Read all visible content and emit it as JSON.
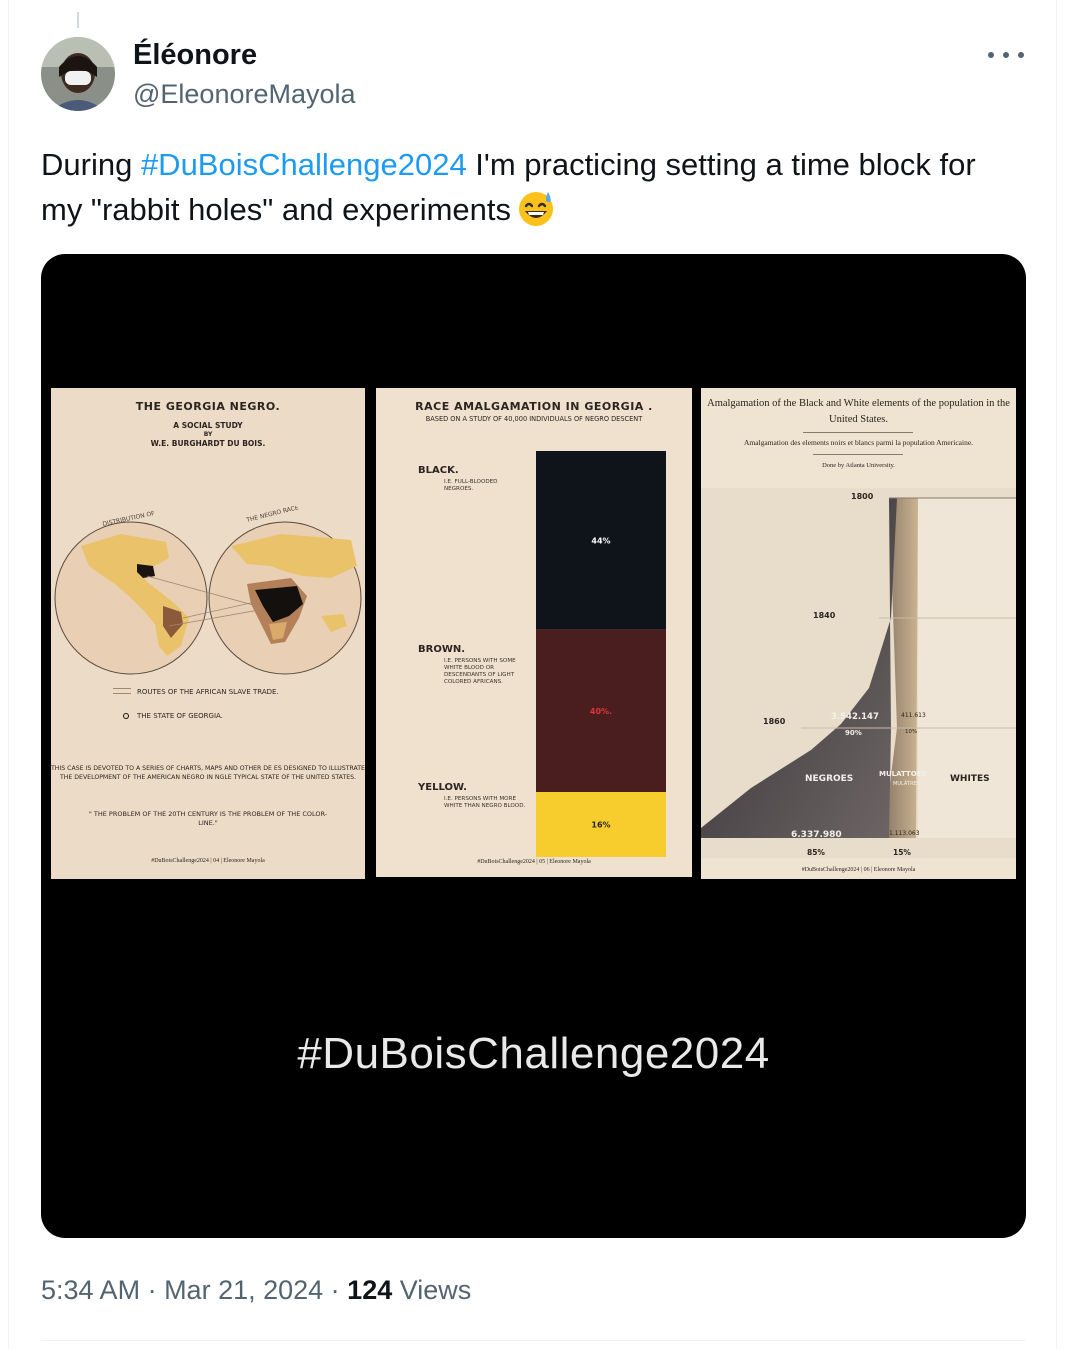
{
  "author": {
    "name": "Éléonore",
    "handle": "@EleonoreMayola"
  },
  "tweet": {
    "text_1": "During ",
    "hashtag": "#DuBoisChallenge2024",
    "text_2": " I'm practicing setting a time block for my \"rabbit holes\" and experiments",
    "emoji": "grinning-face-with-sweat-icon"
  },
  "media": {
    "panel1": {
      "title": "THE GEORGIA NEGRO.",
      "subtitle": "A SOCIAL STUDY",
      "by": "BY",
      "author": "W.E. BURGHARDT DU BOIS.",
      "arc_left": "DISTRIBUTION OF",
      "arc_right": "THE NEGRO RACE",
      "legend_routes": "ROUTES OF THE AFRICAN SLAVE TRADE.",
      "legend_state": "THE STATE OF GEORGIA.",
      "paragraph": "THIS CASE IS DEVOTED TO A SERIES OF CHARTS, MAPS AND OTHER DE ES DESIGNED TO ILLUSTRATE THE DEVELOPMENT OF THE AMERICAN NEGRO IN NGLE TYPICAL STATE OF THE UNITED STATES.",
      "quote": "\" THE PROBLEM OF THE 20TH CENTURY IS THE PROBLEM OF THE COLOR-LINE.\"",
      "footer": "#DuBoisChallenge2024 | 04 | Eleonore Mayola"
    },
    "panel2": {
      "title": "RACE AMALGAMATION IN GEORGIA .",
      "subtitle": "BASED ON A STUDY OF 40,000 INDIVIDUALS OF NEGRO DESCENT",
      "footer": "#DuBoisChallenge2024 | 05 | Eleonore Mayola",
      "chart_data": {
        "type": "bar",
        "stacked": true,
        "categories": [
          "BLACK.",
          "BROWN.",
          "YELLOW."
        ],
        "descriptions": [
          "I.E. FULL-BLOODED NEGROES.",
          "I.E. PERSONS WITH SOME WHITE BLOOD OR DESCENDANTS OF LIGHT COLORED AFRICANS.",
          "I.E. PERSONS WITH MORE WHITE THAN NEGRO BLOOD."
        ],
        "values": [
          44,
          40,
          16
        ],
        "labels": [
          "44%",
          "40%.",
          "16%"
        ],
        "colors": [
          "#0f131a",
          "#4a1d1f",
          "#f6cd2c"
        ],
        "label_colors": [
          "#ffffff",
          "#e0343c",
          "#2b2420"
        ]
      }
    },
    "panel3": {
      "title": "Amalgamation of the Black and White elements of the population in the United States.",
      "subtitle_fr": "Amalgamation des elements noirs et blancs parmi la population Americaine.",
      "credit": "Done by Atlanta University.",
      "years": [
        "1800",
        "1840",
        "1860"
      ],
      "value_main": "3.542.147",
      "value_main_pct": "90%",
      "value_small": "411.613",
      "value_small_pct": "10%",
      "label_negroes": "NEGROES",
      "label_mulattoes": "MULATTOES",
      "label_mulattoes_fr": "MULÂTRES",
      "label_whites": "WHITES",
      "bottom_main": "6.337.980",
      "bottom_main_pct": "85%",
      "bottom_small": "1.113.063",
      "bottom_small_pct": "15%",
      "footer": "#DuBoisChallenge2024 | 06 | Eleonore Mayola"
    },
    "caption": "#DuBoisChallenge2024"
  },
  "meta": {
    "time": "5:34 AM",
    "sep1": " · ",
    "date": "Mar 21, 2024",
    "sep2": " · ",
    "views_count": "124",
    "views_label": " Views"
  }
}
